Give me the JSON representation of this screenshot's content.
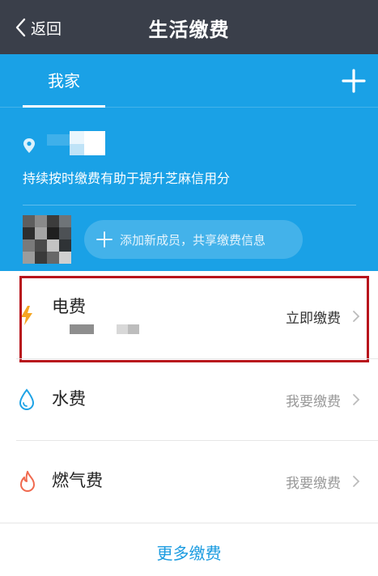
{
  "titlebar": {
    "back_label": "返回",
    "title": "生活缴费"
  },
  "tabs": [
    {
      "label": "我家",
      "active": true
    }
  ],
  "home": {
    "hint": "持续按时缴费有助于提升芝麻信用分",
    "add_member_label": "添加新成员，共享缴费信息"
  },
  "bills": [
    {
      "name": "电费",
      "action": "立即缴费",
      "icon": "lightning-icon",
      "highlighted": true
    },
    {
      "name": "水费",
      "action": "我要缴费",
      "icon": "water-drop-icon",
      "highlighted": false
    },
    {
      "name": "燃气费",
      "action": "我要缴费",
      "icon": "flame-icon",
      "highlighted": false
    }
  ],
  "more_label": "更多缴费",
  "colors": {
    "titlebar": "#3a3f4a",
    "header_blue": "#1aa1e6",
    "highlight_border": "#b8141c",
    "link_blue": "#1a9be0",
    "action_dark": "#333333",
    "action_muted": "#999999"
  }
}
